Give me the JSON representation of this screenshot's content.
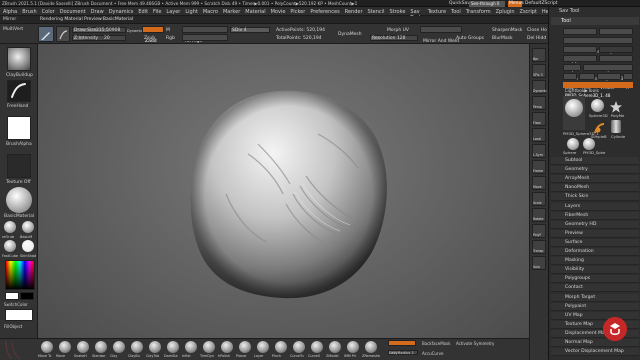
{
  "titlebar": {
    "text": "ZBrush 2021.5.1 [Davide Sasselli]   ZBrush Document   • Free Mem 49.466GB • Active Mem 999 • Scratch Disk 49 • Timer▶0.001 • PolyCount▶520.192 KP • MeshCount▶1",
    "quicksave": "QuickSave",
    "seethrough": "See-through  0",
    "menus": "Menus",
    "defaultzscript": "DefaultZScript"
  },
  "menubar": {
    "items": [
      "Alpha",
      "Brush",
      "Color",
      "Document",
      "Draw",
      "Dynamics",
      "Edit",
      "File",
      "Layer",
      "Light",
      "Macro",
      "Marker",
      "Material",
      "Movie",
      "Picker",
      "Preferences",
      "Render",
      "Stencil",
      "Stroke",
      "Sav Tools",
      "Texture",
      "Tool",
      "Transform",
      "Zplugin",
      "Zscript",
      "Help"
    ]
  },
  "strip": {
    "mirror": "Mirror",
    "multi": "MultiVert",
    "preview": "Rendering Material Preview:BasicMaterial"
  },
  "toolbar": {
    "draw_size_label": "Draw Size",
    "draw_size": "215.50908",
    "dynamic": "Dynamic",
    "z_intensity_label": "Z Intensity",
    "z_intensity": "20",
    "zadd": "Zadd",
    "zsub": "Zsub",
    "m": "M",
    "rgb": "Rgb",
    "all_high": "All High",
    "all_low": "All Low",
    "sdiv": "SDiv 4",
    "active_points": "ActivePoints: 520,194",
    "total_points": "TotalPoints: 520,194",
    "dynamesh": "DynaMesh",
    "morph_uv": "Morph UV",
    "resolution": "Resolution 128",
    "mirror_weld": "Mirror And Weld",
    "auto_groups": "Auto Groups",
    "sharpen_mask": "SharpenMask",
    "blur_mask": "BlurMask",
    "close_holes": "Close Ho",
    "del_hidden": "Del Hidd"
  },
  "leftshelf": {
    "brush_label": "ClayBuildup",
    "stroke_label": "FreeHand",
    "alpha_label": "BrushAlpha",
    "texture_label": "Texture Off",
    "material_label": "BasicMaterial",
    "matcaps": [
      "reOrub",
      "BasicM",
      "FastCube",
      "SkinShad"
    ],
    "switch_color": "SwitchColor",
    "fill_object": "FillObject"
  },
  "bottomshelf": {
    "brushes": [
      "Move Tc",
      "Move",
      "SnakeH",
      "Standar",
      "Clay",
      "ClayBu",
      "ClayTub",
      "DamSta",
      "Inflat",
      "TrimDyn",
      "hPolish",
      "Planar",
      "Layer",
      "Pinch",
      "CurveTu",
      "CurveS",
      "ZModel",
      "IMM Pri",
      "ZRemeshe"
    ]
  },
  "bottombar": {
    "lazymouse": "LazyMouse",
    "lazyradius": "LazyRadius 1",
    "backface": "BackfaceMask",
    "accucurve": "AccuCurve",
    "activate_symmetry": "Activate Symmetry",
    "value": "48"
  },
  "rightshelf": {
    "items": [
      "Bpr",
      "SPix 3",
      "Dynamic",
      "Persp",
      "Floor",
      "Local",
      "L.Sym",
      "Frame",
      "Move",
      "Scale",
      "Rotate",
      "PolyF",
      "Transp",
      "Solo"
    ]
  },
  "rpanel": {
    "title": "Sav Tool",
    "tool_header": "Tool",
    "load_tool": "Load Tool",
    "save_as": "Save As",
    "load_from_project": "Load Tools From Project",
    "copy_tool": "Copy Tool",
    "paste_tool": "Paste Tool",
    "import": "Import",
    "export": "Export",
    "clone": "Clone",
    "make_polymesh": "Make PolyMesh3D",
    "goz": "GoZ",
    "all": "All",
    "visible": "Visible",
    "r": "R",
    "current_tool": "PM3D_Sphere3D_1. 48",
    "lightbox_tools": "Lightbox▶Tools",
    "thumb_labels": [
      "PM3D_Sphere3D_1",
      "Sphere3D",
      "PolyMe",
      "SimpleB",
      "Cylinde",
      "Sphere",
      "PM3D_Sphe"
    ],
    "subpalettes": [
      "Subtool",
      "Geometry",
      "ArrayMesh",
      "NanoMesh",
      "Thick Skin",
      "Layers",
      "FiberMesh",
      "Geometry HD",
      "Preview",
      "Surface",
      "Deformation",
      "Masking",
      "Visibility",
      "Polygroups",
      "Contact",
      "Morph Target",
      "Polypaint",
      "UV Map",
      "Texture Map",
      "Displacement Map",
      "Normal Map",
      "Vector Displacement Map"
    ],
    "accent": "#d46a1c"
  },
  "badge": {
    "icon": "udemy-logo-icon"
  }
}
